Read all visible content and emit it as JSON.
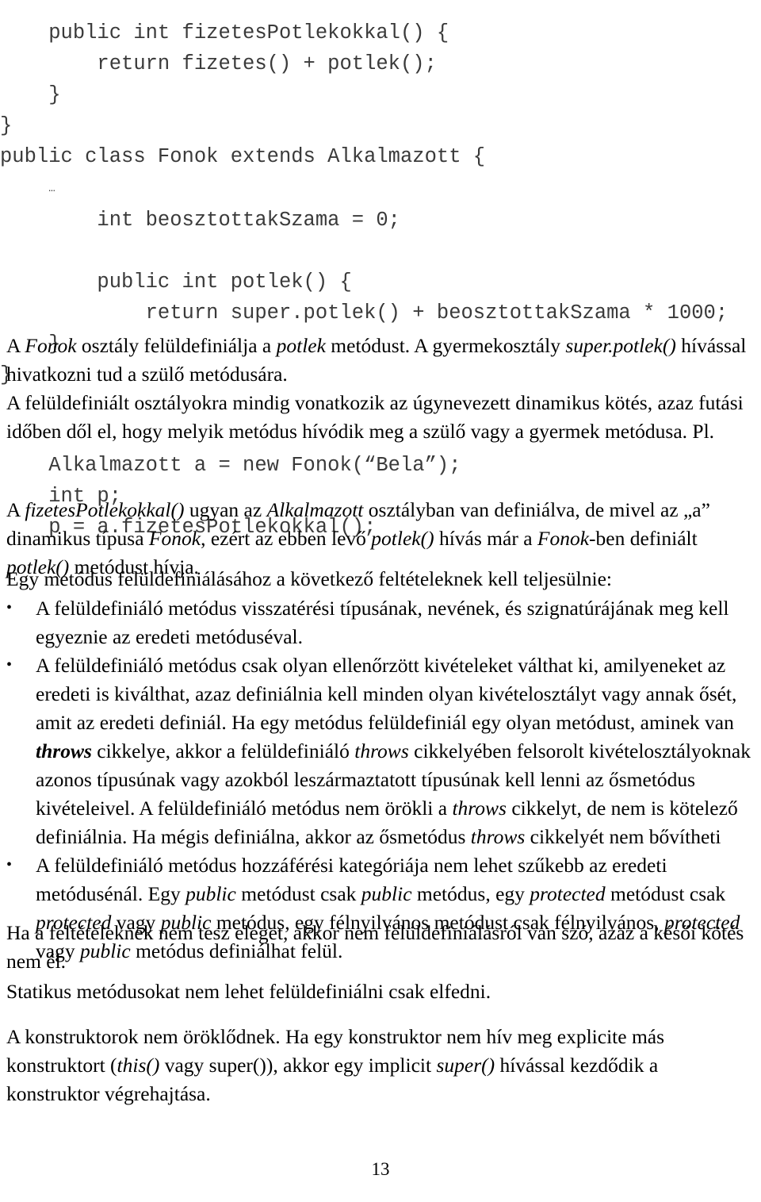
{
  "document": {
    "page_number": "13",
    "language": "hu"
  },
  "code_blocks": [
    {
      "name": "fizetesPotlekokkal-method",
      "lines": [
        "    public int fizetesPotlekokkal() {",
        "        return fizetes() + potlek();",
        "    }",
        "}"
      ]
    },
    {
      "name": "fonok-class",
      "lines": [
        "public class Fonok extends Alkalmazott {",
        "    …",
        "        int beosztottakSzama = 0;",
        "",
        "    public int potlek() {",
        "        return super.potlek() + beosztottakSzama * 1000;",
        "    }",
        "}"
      ]
    },
    {
      "name": "dynamic-binding-example",
      "lines": [
        "    Alkalmazott a = new Fonok(“Bela”);",
        "    int p;",
        "    p = a.fizetesPotlekokkal();"
      ]
    }
  ],
  "paragraphs": {
    "fonok_override": {
      "s1": "A ",
      "i1": "Fonok",
      "s2": " osztály felüldefiniálja a ",
      "i2": "potlek",
      "s3": " metódust. A gyermekosztály ",
      "i3": "super.potlek()",
      "s4": " hívással hivatkozni tud a szülő metódusára."
    },
    "dynamic_binding": {
      "s1": "A felüldefiniált osztályokra mindig vonatkozik az úgynevezett dinamikus kötés, azaz futási időben dől el, hogy melyik metódus hívódik meg a szülő vagy a gyermek metódusa. Pl."
    },
    "fizetes_explain": {
      "s1": "A ",
      "i1": "fizetesPotlekokkal()",
      "s2": " ugyan az ",
      "i2": "Alkalmazott",
      "s3": " osztályban van definiálva, de mivel az „a” dinamikus típusa ",
      "i3": "Fonok",
      "s4": ", ezért az ebben levő ",
      "i4": "potlek()",
      "s5": " hívás már a ",
      "i5": "Fonok",
      "s6": "-ben definiált ",
      "i6": "potlek()",
      "s7": " metódust hívja."
    },
    "conditions_intro": {
      "s1": "Egy metódus felüldefiniálásához a következő feltételeknek kell teljesülnie:"
    },
    "not_override": {
      "s1": "Ha a feltételeknek nem tesz eleget, akkor nem felüldefiniálásról van szó, azaz a késői kötés nem él."
    },
    "static_methods": {
      "s1": "Statikus metódusokat nem lehet felüldefiniálni csak elfedni."
    },
    "constructors": {
      "s1": "A konstruktorok nem öröklődnek. Ha egy konstruktor nem hív meg explicite más konstruktort (",
      "i1": "this()",
      "s2": " vagy super()), akkor egy implicit ",
      "i2": "super()",
      "s3": " hívással kezdődik a konstruktor végrehajtása."
    }
  },
  "bullets": [
    {
      "marker": "•",
      "segments": [
        {
          "type": "text",
          "value": "A felüldefiniáló metódus visszatérési típusának, nevének, és szignatúrájának meg kell egyeznie az eredeti metóduséval."
        }
      ]
    },
    {
      "marker": "•",
      "segments": [
        {
          "type": "text",
          "value": "A felüldefiniáló metódus csak olyan ellenőrzött kivételeket válthat ki, amilyeneket az eredeti is kiválthat, azaz definiálnia kell minden olyan kivételosztályt vagy annak ősét, amit az eredeti definiál. Ha egy metódus felüldefiniál egy olyan metódust, aminek van "
        },
        {
          "type": "bold-italic",
          "value": "throws"
        },
        {
          "type": "text",
          "value": " cikkelye, akkor a felüldefiniáló "
        },
        {
          "type": "italic",
          "value": "throws"
        },
        {
          "type": "text",
          "value": " cikkelyében felsorolt kivételosztályoknak azonos típusúnak vagy azokból leszármaztatott típusúnak kell lenni az ősmetódus kivételeivel. A felüldefiniáló metódus nem örökli a "
        },
        {
          "type": "italic",
          "value": "throws"
        },
        {
          "type": "text",
          "value": " cikkelyt, de nem is kötelező definiálnia. Ha mégis definiálna, akkor az ősmetódus "
        },
        {
          "type": "italic",
          "value": "throws"
        },
        {
          "type": "text",
          "value": " cikkelyét nem bővítheti"
        }
      ]
    },
    {
      "marker": "•",
      "segments": [
        {
          "type": "text",
          "value": "A felüldefiniáló metódus hozzáférési kategóriája nem lehet szűkebb az eredeti metódusénál. Egy "
        },
        {
          "type": "italic",
          "value": "public"
        },
        {
          "type": "text",
          "value": " metódust csak "
        },
        {
          "type": "italic",
          "value": "public"
        },
        {
          "type": "text",
          "value": " metódus, egy "
        },
        {
          "type": "italic",
          "value": "protected"
        },
        {
          "type": "text",
          "value": " metódust csak "
        },
        {
          "type": "italic",
          "value": "protected"
        },
        {
          "type": "text",
          "value": " vagy "
        },
        {
          "type": "italic",
          "value": "public"
        },
        {
          "type": "text",
          "value": " metódus, egy félnyilvános metódust csak félnyilvános, "
        },
        {
          "type": "italic",
          "value": "protected"
        },
        {
          "type": "text",
          "value": " vagy "
        },
        {
          "type": "italic",
          "value": "public"
        },
        {
          "type": "text",
          "value": " metódus definiálhat felül."
        }
      ]
    }
  ],
  "colors": {
    "code_text": "#3a3a3a",
    "body_text": "#000000",
    "background": "#ffffff"
  }
}
